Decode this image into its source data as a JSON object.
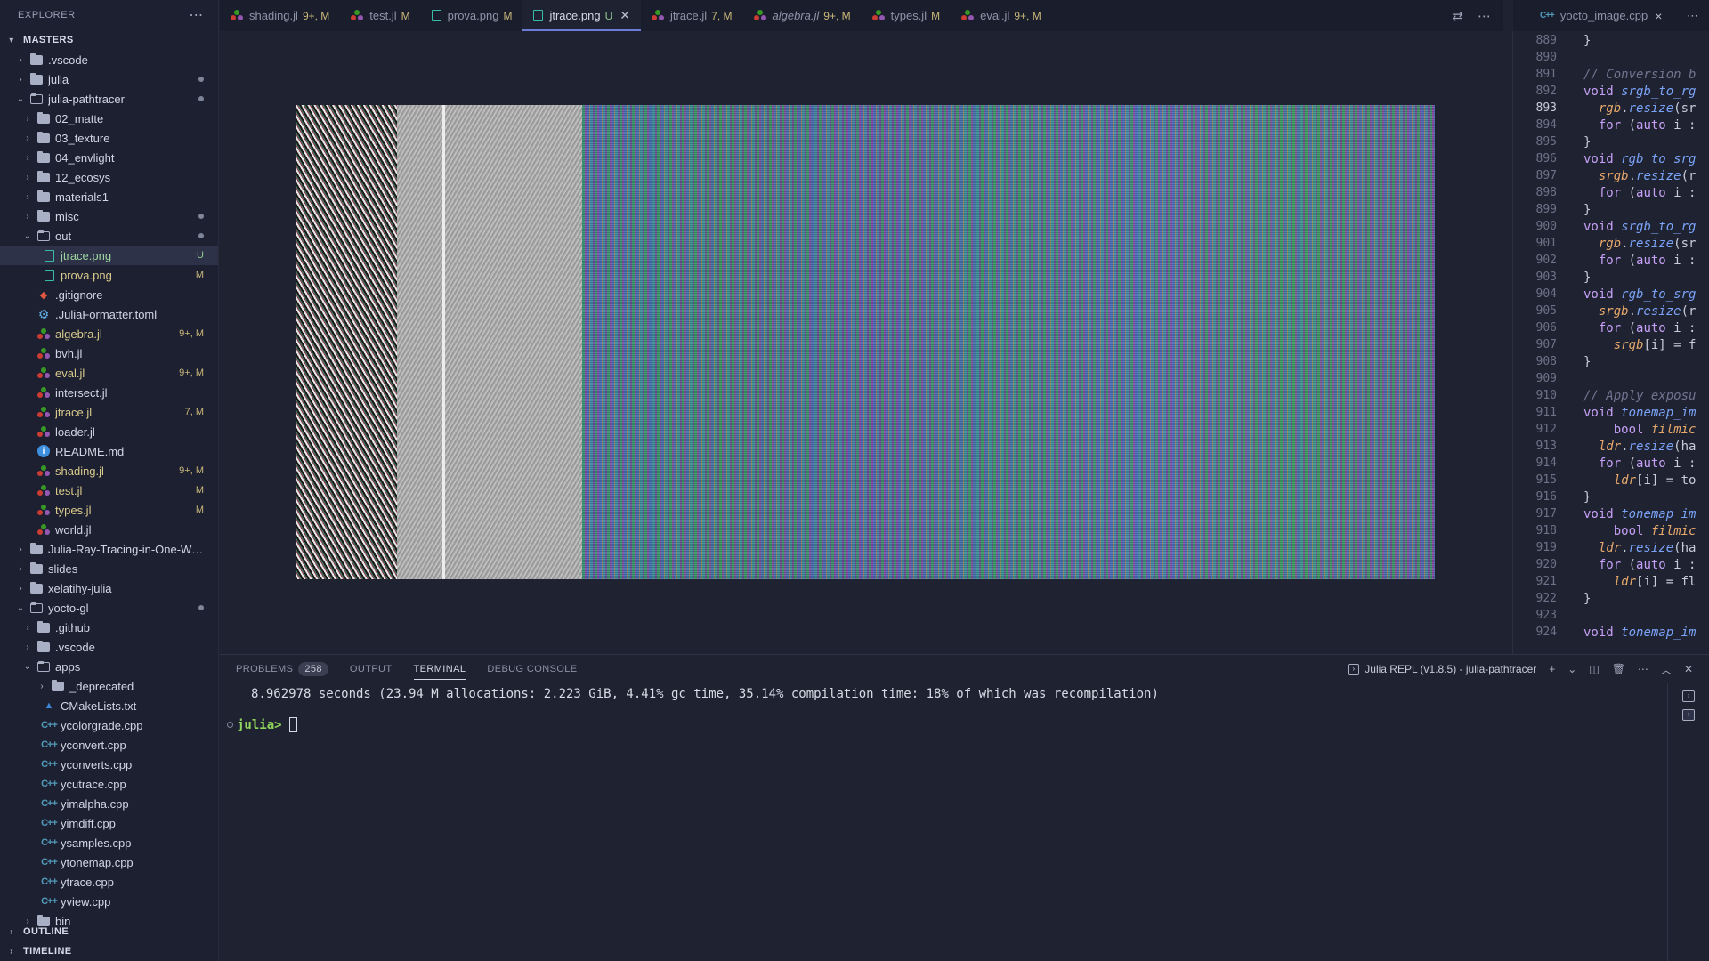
{
  "sidebar": {
    "title": "EXPLORER",
    "more": "⋯",
    "root": "MASTERS",
    "items": [
      {
        "label": ".vscode",
        "kind": "folder",
        "depth": 1,
        "open": false
      },
      {
        "label": "julia",
        "kind": "folder",
        "depth": 1,
        "open": false,
        "dot": true
      },
      {
        "label": "julia-pathtracer",
        "kind": "folder",
        "depth": 1,
        "open": true,
        "dot": true
      },
      {
        "label": "02_matte",
        "kind": "folder",
        "depth": 2,
        "open": false
      },
      {
        "label": "03_texture",
        "kind": "folder",
        "depth": 2,
        "open": false
      },
      {
        "label": "04_envlight",
        "kind": "folder",
        "depth": 2,
        "open": false
      },
      {
        "label": "12_ecosys",
        "kind": "folder",
        "depth": 2,
        "open": false
      },
      {
        "label": "materials1",
        "kind": "folder",
        "depth": 2,
        "open": false
      },
      {
        "label": "misc",
        "kind": "folder",
        "depth": 2,
        "open": false,
        "dot": true
      },
      {
        "label": "out",
        "kind": "folder",
        "depth": 2,
        "open": true,
        "dot": true
      },
      {
        "label": "jtrace.png",
        "kind": "image",
        "depth": 3,
        "badge": "U",
        "selected": true
      },
      {
        "label": "prova.png",
        "kind": "image",
        "depth": 3,
        "badge": "M"
      },
      {
        "label": ".gitignore",
        "kind": "git",
        "depth": 2
      },
      {
        "label": ".JuliaFormatter.toml",
        "kind": "gear",
        "depth": 2
      },
      {
        "label": "algebra.jl",
        "kind": "julia",
        "depth": 2,
        "badge": "9+, M"
      },
      {
        "label": "bvh.jl",
        "kind": "julia",
        "depth": 2
      },
      {
        "label": "eval.jl",
        "kind": "julia",
        "depth": 2,
        "badge": "9+, M"
      },
      {
        "label": "intersect.jl",
        "kind": "julia",
        "depth": 2
      },
      {
        "label": "jtrace.jl",
        "kind": "julia",
        "depth": 2,
        "badge": "7, M"
      },
      {
        "label": "loader.jl",
        "kind": "julia",
        "depth": 2
      },
      {
        "label": "README.md",
        "kind": "info",
        "depth": 2
      },
      {
        "label": "shading.jl",
        "kind": "julia",
        "depth": 2,
        "badge": "9+, M"
      },
      {
        "label": "test.jl",
        "kind": "julia",
        "depth": 2,
        "badge": "M"
      },
      {
        "label": "types.jl",
        "kind": "julia",
        "depth": 2,
        "badge": "M"
      },
      {
        "label": "world.jl",
        "kind": "julia",
        "depth": 2
      },
      {
        "label": "Julia-Ray-Tracing-in-One-We...",
        "kind": "folder",
        "depth": 1,
        "open": false
      },
      {
        "label": "slides",
        "kind": "folder",
        "depth": 1,
        "open": false
      },
      {
        "label": "xelatihy-julia",
        "kind": "folder",
        "depth": 1,
        "open": false
      },
      {
        "label": "yocto-gl",
        "kind": "folder",
        "depth": 1,
        "open": true,
        "dot": true
      },
      {
        "label": ".github",
        "kind": "folder",
        "depth": 2,
        "open": false
      },
      {
        "label": ".vscode",
        "kind": "folder",
        "depth": 2,
        "open": false
      },
      {
        "label": "apps",
        "kind": "folder",
        "depth": 2,
        "open": true
      },
      {
        "label": "_deprecated",
        "kind": "folder",
        "depth": 3,
        "open": false
      },
      {
        "label": "CMakeLists.txt",
        "kind": "cmake",
        "depth": 3
      },
      {
        "label": "ycolorgrade.cpp",
        "kind": "cpp",
        "depth": 3
      },
      {
        "label": "yconvert.cpp",
        "kind": "cpp",
        "depth": 3
      },
      {
        "label": "yconverts.cpp",
        "kind": "cpp",
        "depth": 3
      },
      {
        "label": "ycutrace.cpp",
        "kind": "cpp",
        "depth": 3
      },
      {
        "label": "yimalpha.cpp",
        "kind": "cpp",
        "depth": 3
      },
      {
        "label": "yimdiff.cpp",
        "kind": "cpp",
        "depth": 3
      },
      {
        "label": "ysamples.cpp",
        "kind": "cpp",
        "depth": 3
      },
      {
        "label": "ytonemap.cpp",
        "kind": "cpp",
        "depth": 3
      },
      {
        "label": "ytrace.cpp",
        "kind": "cpp",
        "depth": 3
      },
      {
        "label": "yview.cpp",
        "kind": "cpp",
        "depth": 3
      },
      {
        "label": "bin",
        "kind": "folder",
        "depth": 2,
        "open": false
      }
    ],
    "outline": "OUTLINE",
    "timeline": "TIMELINE"
  },
  "tabs": [
    {
      "label": "shading.jl",
      "badge": "9+, M",
      "kind": "julia"
    },
    {
      "label": "test.jl",
      "badge": "M",
      "kind": "julia"
    },
    {
      "label": "prova.png",
      "badge": "M",
      "kind": "image"
    },
    {
      "label": "jtrace.png",
      "badge": "U",
      "kind": "image",
      "active": true
    },
    {
      "label": "jtrace.jl",
      "badge": "7, M",
      "kind": "julia"
    },
    {
      "label": "algebra.jl",
      "badge": "9+, M",
      "kind": "julia",
      "italic": true
    },
    {
      "label": "types.jl",
      "badge": "M",
      "kind": "julia"
    },
    {
      "label": "eval.jl",
      "badge": "9+, M",
      "kind": "julia"
    }
  ],
  "right_tab": {
    "label": "yocto_image.cpp",
    "close": "×",
    "more": "⋯"
  },
  "code_lines": [
    {
      "n": "889",
      "t": "}"
    },
    {
      "n": "890",
      "t": ""
    },
    {
      "n": "891",
      "t": "// Conversion b",
      "c": true
    },
    {
      "n": "892",
      "t": "void srgb_to_rg"
    },
    {
      "n": "893",
      "t": "  rgb.resize(sr",
      "cur": true
    },
    {
      "n": "894",
      "t": "  for (auto i :"
    },
    {
      "n": "895",
      "t": "}"
    },
    {
      "n": "896",
      "t": "void rgb_to_srg"
    },
    {
      "n": "897",
      "t": "  srgb.resize(r"
    },
    {
      "n": "898",
      "t": "  for (auto i :"
    },
    {
      "n": "899",
      "t": "}"
    },
    {
      "n": "900",
      "t": "void srgb_to_rg"
    },
    {
      "n": "901",
      "t": "  rgb.resize(sr"
    },
    {
      "n": "902",
      "t": "  for (auto i :"
    },
    {
      "n": "903",
      "t": "}"
    },
    {
      "n": "904",
      "t": "void rgb_to_srg"
    },
    {
      "n": "905",
      "t": "  srgb.resize(r"
    },
    {
      "n": "906",
      "t": "  for (auto i :"
    },
    {
      "n": "907",
      "t": "    srgb[i] = f"
    },
    {
      "n": "908",
      "t": "}"
    },
    {
      "n": "909",
      "t": ""
    },
    {
      "n": "910",
      "t": "// Apply exposu",
      "c": true
    },
    {
      "n": "911",
      "t": "void tonemap_im"
    },
    {
      "n": "912",
      "t": "    bool filmic"
    },
    {
      "n": "913",
      "t": "  ldr.resize(ha"
    },
    {
      "n": "914",
      "t": "  for (auto i :"
    },
    {
      "n": "915",
      "t": "    ldr[i] = to"
    },
    {
      "n": "916",
      "t": "}"
    },
    {
      "n": "917",
      "t": "void tonemap_im"
    },
    {
      "n": "918",
      "t": "    bool filmic"
    },
    {
      "n": "919",
      "t": "  ldr.resize(ha"
    },
    {
      "n": "920",
      "t": "  for (auto i :"
    },
    {
      "n": "921",
      "t": "    ldr[i] = fl"
    },
    {
      "n": "922",
      "t": "}"
    },
    {
      "n": "923",
      "t": ""
    },
    {
      "n": "924",
      "t": "void tonemap_im"
    }
  ],
  "panel": {
    "tabs": [
      {
        "label": "PROBLEMS",
        "count": "258"
      },
      {
        "label": "OUTPUT"
      },
      {
        "label": "TERMINAL",
        "active": true
      },
      {
        "label": "DEBUG CONSOLE"
      }
    ],
    "terminal_name": "Julia REPL (v1.8.5) - julia-pathtracer",
    "output": "8.962978 seconds (23.94 M allocations: 2.223 GiB, 4.41% gc time, 35.14% compilation time: 18% of which was recompilation)",
    "prompt": "julia>"
  },
  "colors": {
    "accent": "#6c7bd6",
    "modified": "#c9b87a",
    "untracked": "#8dc891",
    "prompt": "#8fd45d"
  }
}
